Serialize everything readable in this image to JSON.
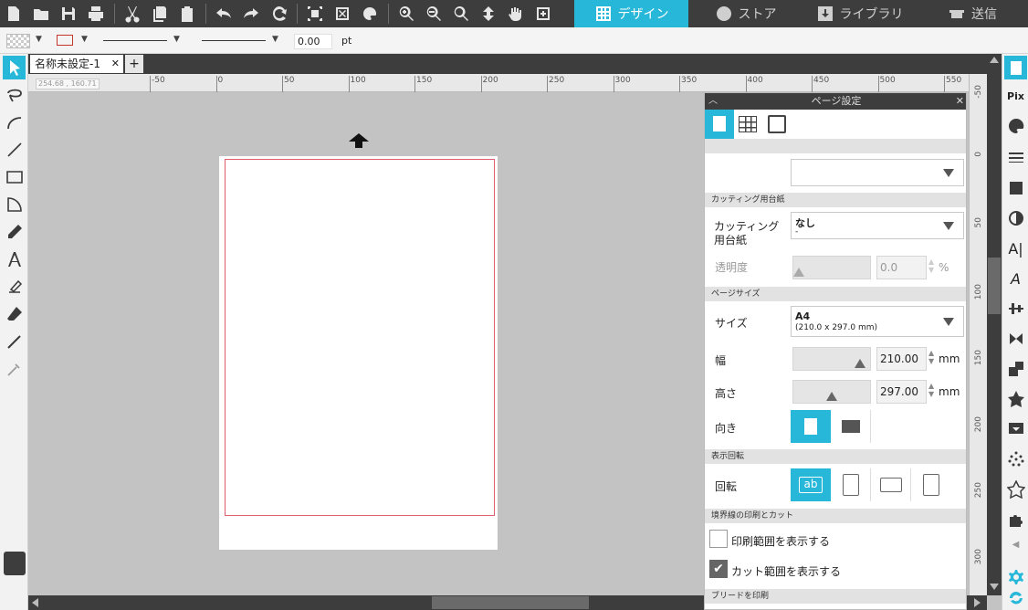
{
  "tabs": {
    "design": "デザイン",
    "store": "ストア",
    "library": "ライブラリ",
    "send": "送信"
  },
  "toolbar2": {
    "line_width": "0.00",
    "line_unit": "pt"
  },
  "document": {
    "tab_name": "名称未設定-1",
    "add_tab": "+",
    "cursor_coords": "254.68 , 160.71"
  },
  "ruler": {
    "h_ticks": [
      "-50",
      "0",
      "50",
      "100",
      "150",
      "200",
      "250",
      "300",
      "350",
      "400",
      "450",
      "500",
      "550"
    ],
    "v_ticks": [
      "-50",
      "0",
      "50",
      "100",
      "150",
      "200",
      "250",
      "300"
    ]
  },
  "panel": {
    "title": "ページ設定",
    "sections": {
      "cutting_mat": "カッティング用台紙",
      "page_size": "ページサイズ",
      "display_rotation": "表示回転",
      "border": "境界線の印刷とカット",
      "bleed": "ブリードを印刷"
    },
    "cutting_mat": {
      "label": "カッティング用台紙",
      "value": "なし",
      "sub": "-"
    },
    "transparency": {
      "label": "透明度",
      "value": "0.0",
      "unit": "%",
      "level": 0
    },
    "size": {
      "label": "サイズ",
      "value": "A4",
      "sub": "(210.0 x 297.0 mm)"
    },
    "width": {
      "label": "幅",
      "value": "210.00",
      "unit": "mm",
      "level": 0.93
    },
    "height": {
      "label": "高さ",
      "value": "297.00",
      "unit": "mm",
      "level": 0.5
    },
    "orientation": {
      "label": "向き"
    },
    "rotation": {
      "label": "回転"
    },
    "show_print": {
      "label": "印刷範囲を表示する",
      "checked": false
    },
    "show_cut": {
      "label": "カット範囲を表示する",
      "checked": true
    }
  },
  "colors": {
    "accent": "#26b7d9",
    "dark": "#3d3d3d"
  }
}
